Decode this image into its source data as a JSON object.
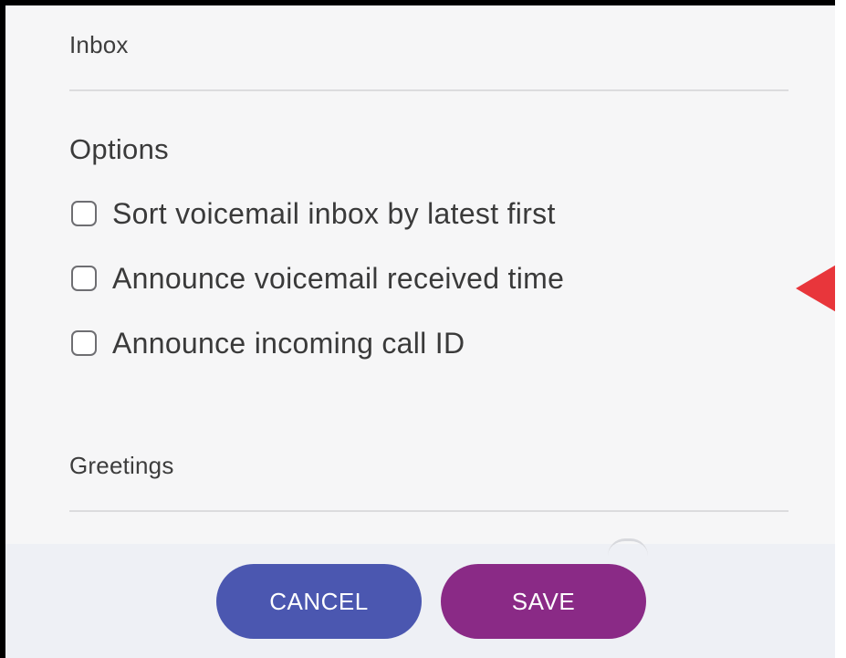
{
  "inbox": {
    "label": "Inbox"
  },
  "options": {
    "heading": "Options",
    "items": [
      {
        "label": "Sort voicemail inbox by latest first",
        "checked": false
      },
      {
        "label": "Announce voicemail received time",
        "checked": false
      },
      {
        "label": "Announce incoming call ID",
        "checked": false
      }
    ]
  },
  "greetings": {
    "label": "Greetings"
  },
  "footer": {
    "cancel_label": "CANCEL",
    "save_label": "SAVE"
  },
  "colors": {
    "cancel_button": "#4b57b0",
    "save_button": "#8a2a86",
    "annotation_arrow": "#e8363b"
  },
  "icons": {
    "annotation": "red-left-pointing-arrow-icon"
  }
}
